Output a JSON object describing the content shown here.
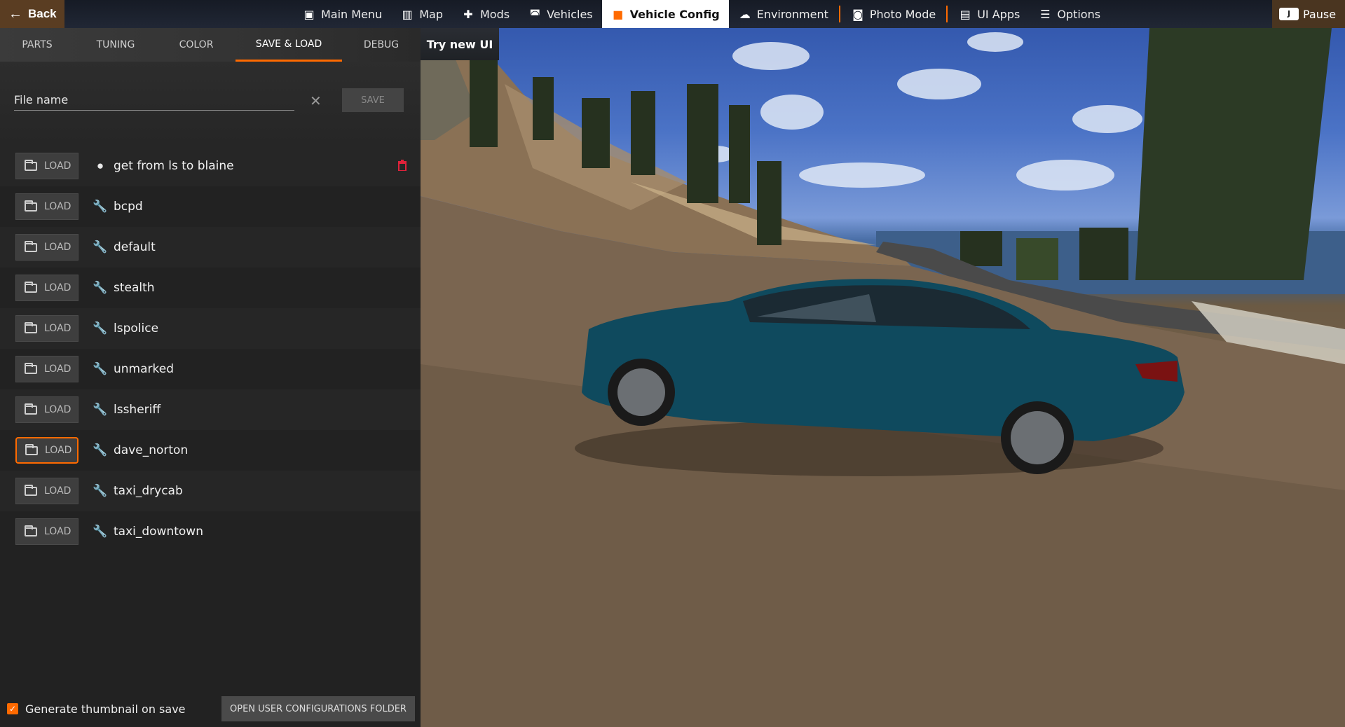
{
  "topbar": {
    "back_label": "Back",
    "nav": [
      {
        "label": "Main Menu",
        "icon": "main-menu-icon"
      },
      {
        "label": "Map",
        "icon": "map-icon"
      },
      {
        "label": "Mods",
        "icon": "puzzle-icon"
      },
      {
        "label": "Vehicles",
        "icon": "car-icon"
      },
      {
        "label": "Vehicle Config",
        "icon": "engine-icon",
        "active": true
      },
      {
        "label": "Environment",
        "icon": "weather-icon"
      },
      {
        "label": "Photo Mode",
        "icon": "camera-icon"
      },
      {
        "label": "UI Apps",
        "icon": "ui-apps-icon"
      },
      {
        "label": "Options",
        "icon": "sliders-icon"
      }
    ],
    "pause_label": "Pause"
  },
  "panel": {
    "tabs": [
      {
        "label": "PARTS"
      },
      {
        "label": "TUNING"
      },
      {
        "label": "COLOR"
      },
      {
        "label": "SAVE & LOAD",
        "active": true
      },
      {
        "label": "DEBUG"
      }
    ],
    "file_name_placeholder": "File name",
    "save_label": "SAVE",
    "load_label": "LOAD",
    "configs": [
      {
        "name": "get from ls to blaine",
        "type": "user"
      },
      {
        "name": "bcpd",
        "type": "stock"
      },
      {
        "name": "default",
        "type": "stock"
      },
      {
        "name": "stealth",
        "type": "stock"
      },
      {
        "name": "lspolice",
        "type": "stock"
      },
      {
        "name": "unmarked",
        "type": "stock"
      },
      {
        "name": "lssheriff",
        "type": "stock"
      },
      {
        "name": "dave_norton",
        "type": "stock"
      },
      {
        "name": "taxi_drycab",
        "type": "stock"
      },
      {
        "name": "taxi_downtown",
        "type": "stock"
      }
    ],
    "generate_thumbnail_label": "Generate thumbnail on save",
    "generate_thumbnail_checked": true,
    "open_folder_label": "OPEN USER CONFIGURATIONS FOLDER"
  },
  "try_new_ui_label": "Try new UI",
  "colors": {
    "accent": "#ff6a00",
    "delete": "#e0223a"
  }
}
